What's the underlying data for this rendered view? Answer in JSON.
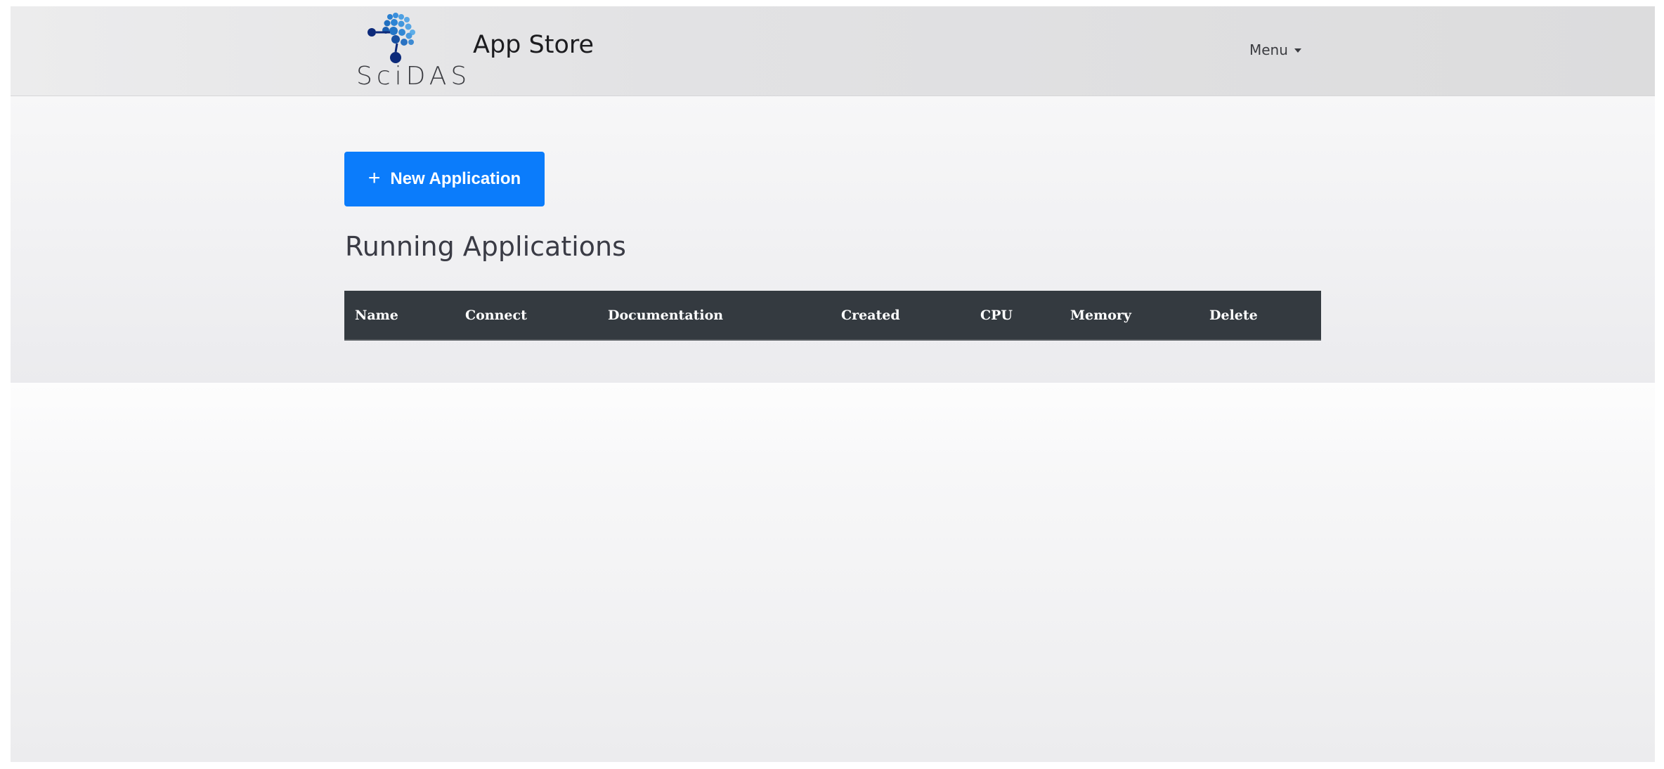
{
  "header": {
    "logo_text": "SciDAS",
    "app_title": "App Store",
    "menu_label": "Menu"
  },
  "main": {
    "new_button_label": "New Application",
    "section_title": "Running Applications",
    "table": {
      "columns": [
        "Name",
        "Connect",
        "Documentation",
        "Created",
        "CPU",
        "Memory",
        "Delete"
      ],
      "rows": []
    }
  },
  "colors": {
    "primary": "#0b7cfb",
    "table_header_bg": "#343a40",
    "logo_blue": "#1f7fd0",
    "logo_navy": "#0d2a7a"
  },
  "icons": {
    "logo": "scidas-network-logo-icon",
    "add": "plus-icon",
    "menu_caret": "caret-down-icon"
  }
}
